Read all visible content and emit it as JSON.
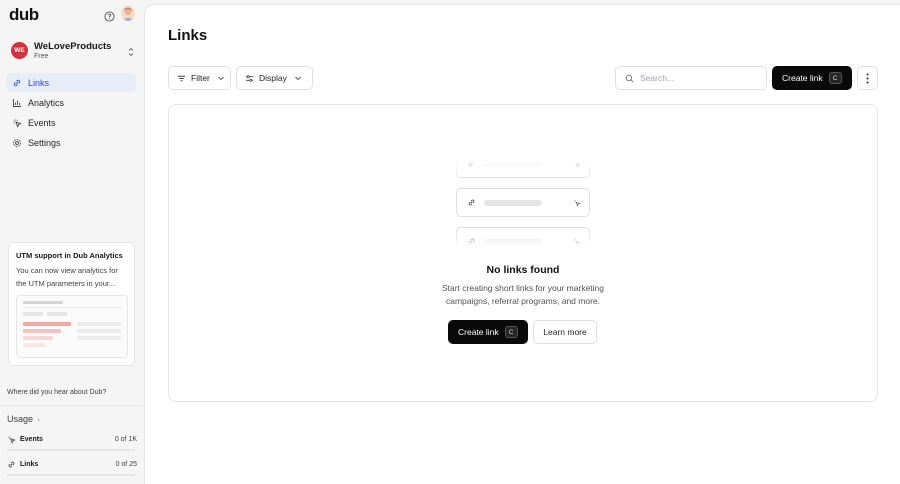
{
  "app": {
    "logo": "dub"
  },
  "workspace": {
    "initials": "WE",
    "name": "WeLoveProducts",
    "plan": "Free"
  },
  "nav": {
    "items": [
      {
        "label": "Links",
        "icon": "link-icon",
        "active": true
      },
      {
        "label": "Analytics",
        "icon": "bar-chart-icon",
        "active": false
      },
      {
        "label": "Events",
        "icon": "cursor-rays-icon",
        "active": false
      },
      {
        "label": "Settings",
        "icon": "gear-icon",
        "active": false
      }
    ]
  },
  "promo": {
    "title": "UTM support in Dub Analytics",
    "text": "You can now view analytics for the UTM parameters in your..."
  },
  "referral": {
    "question": "Where did you hear about Dub?"
  },
  "usage": {
    "title": "Usage",
    "rows": [
      {
        "label": "Events",
        "value": "0 of 1K",
        "fraction": 0
      },
      {
        "label": "Links",
        "value": "0 of 25",
        "fraction": 0
      }
    ]
  },
  "page": {
    "title": "Links"
  },
  "toolbar": {
    "filter_label": "Filter",
    "display_label": "Display",
    "search_placeholder": "Search...",
    "create_label": "Create link",
    "create_shortcut": "C"
  },
  "empty_state": {
    "title": "No links found",
    "description": "Start creating short links for your marketing campaigns, referral programs, and more.",
    "create_label": "Create link",
    "create_shortcut": "C",
    "learn_label": "Learn more"
  },
  "colors": {
    "accent": "#1d4ed8",
    "active_bg": "#e6edf7",
    "workspace_avatar": "#d0333e",
    "primary_button": "#0a0a0a"
  }
}
